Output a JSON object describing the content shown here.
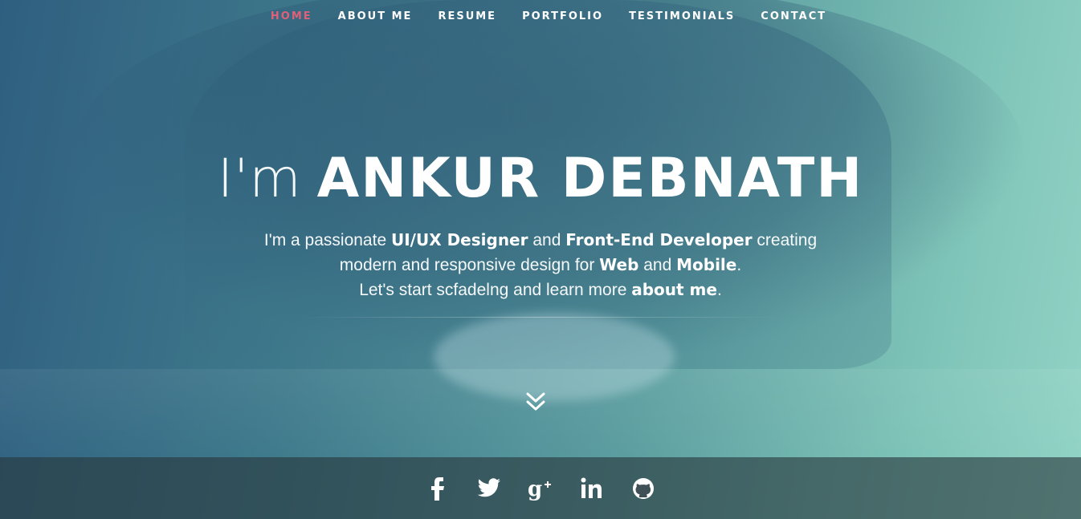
{
  "nav": {
    "items": [
      {
        "label": "HOME",
        "active": true
      },
      {
        "label": "ABOUT ME",
        "active": false
      },
      {
        "label": "RESUME",
        "active": false
      },
      {
        "label": "PORTFOLIO",
        "active": false
      },
      {
        "label": "TESTIMONIALS",
        "active": false
      },
      {
        "label": "CONTACT",
        "active": false
      }
    ],
    "active_color": "#e0607a"
  },
  "hero": {
    "prefix": "I'm",
    "name": "ANKUR DEBNATH",
    "line1": {
      "t1": "I'm a passionate ",
      "b1": "UI/UX Designer",
      "t2": " and ",
      "b2": "Front-End Developer",
      "t3": " creating"
    },
    "line2": {
      "t1": "modern and responsive design for ",
      "b1": "Web",
      "t2": " and ",
      "b2": "Mobile",
      "t3": "."
    },
    "line3": {
      "t1": "Let's start scfadelng and learn more ",
      "b1": "about me",
      "t2": "."
    }
  },
  "scroll": {
    "icon": "double-chevron-down-icon"
  },
  "social": {
    "icons": [
      "facebook-icon",
      "twitter-icon",
      "google-plus-icon",
      "linkedin-icon",
      "github-icon"
    ]
  },
  "colors": {
    "gradient_left": "#2f5f80",
    "gradient_right": "#92d4c6",
    "social_bar": "#3a4a50"
  }
}
